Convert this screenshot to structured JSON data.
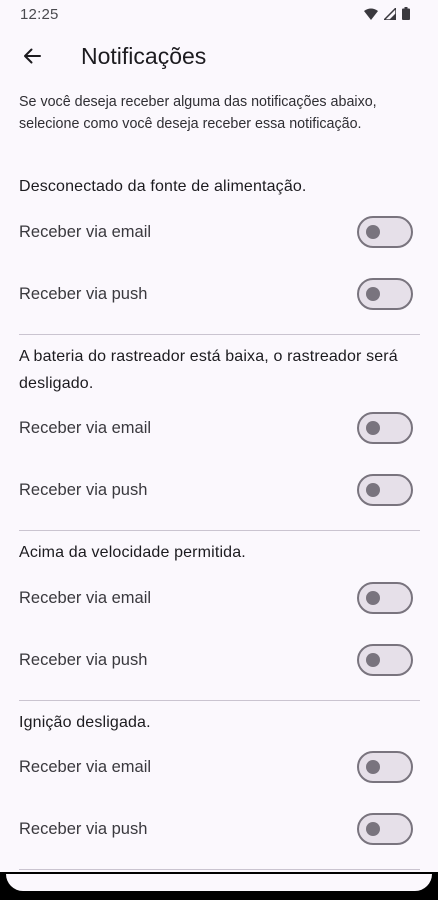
{
  "status_bar": {
    "time": "12:25",
    "icons": [
      "wifi-icon",
      "signal-icon",
      "battery-icon"
    ]
  },
  "app_bar": {
    "back_icon": "arrow-left-icon",
    "title": "Notificações"
  },
  "intro_text": "Se você deseja receber alguma das notificações abaixo, selecione como você deseja receber essa notificação.",
  "sections": [
    {
      "title": "Desconectado da fonte de alimentação.",
      "options": [
        {
          "label": "Receber via email",
          "on": false
        },
        {
          "label": "Receber via push",
          "on": false
        }
      ]
    },
    {
      "title": "A bateria do rastreador está baixa, o rastreador será desligado.",
      "options": [
        {
          "label": "Receber via email",
          "on": false
        },
        {
          "label": "Receber via push",
          "on": false
        }
      ]
    },
    {
      "title": "Acima da velocidade permitida.",
      "options": [
        {
          "label": "Receber via email",
          "on": false
        },
        {
          "label": "Receber via push",
          "on": false
        }
      ]
    },
    {
      "title": "Ignição desligada.",
      "options": [
        {
          "label": "Receber via email",
          "on": false
        },
        {
          "label": "Receber via push",
          "on": false
        }
      ]
    }
  ],
  "colors": {
    "background": "#fbf8fd",
    "toggle_outline": "#79747e",
    "toggle_track": "#e6e0e9",
    "divider": "#cac4d0"
  }
}
